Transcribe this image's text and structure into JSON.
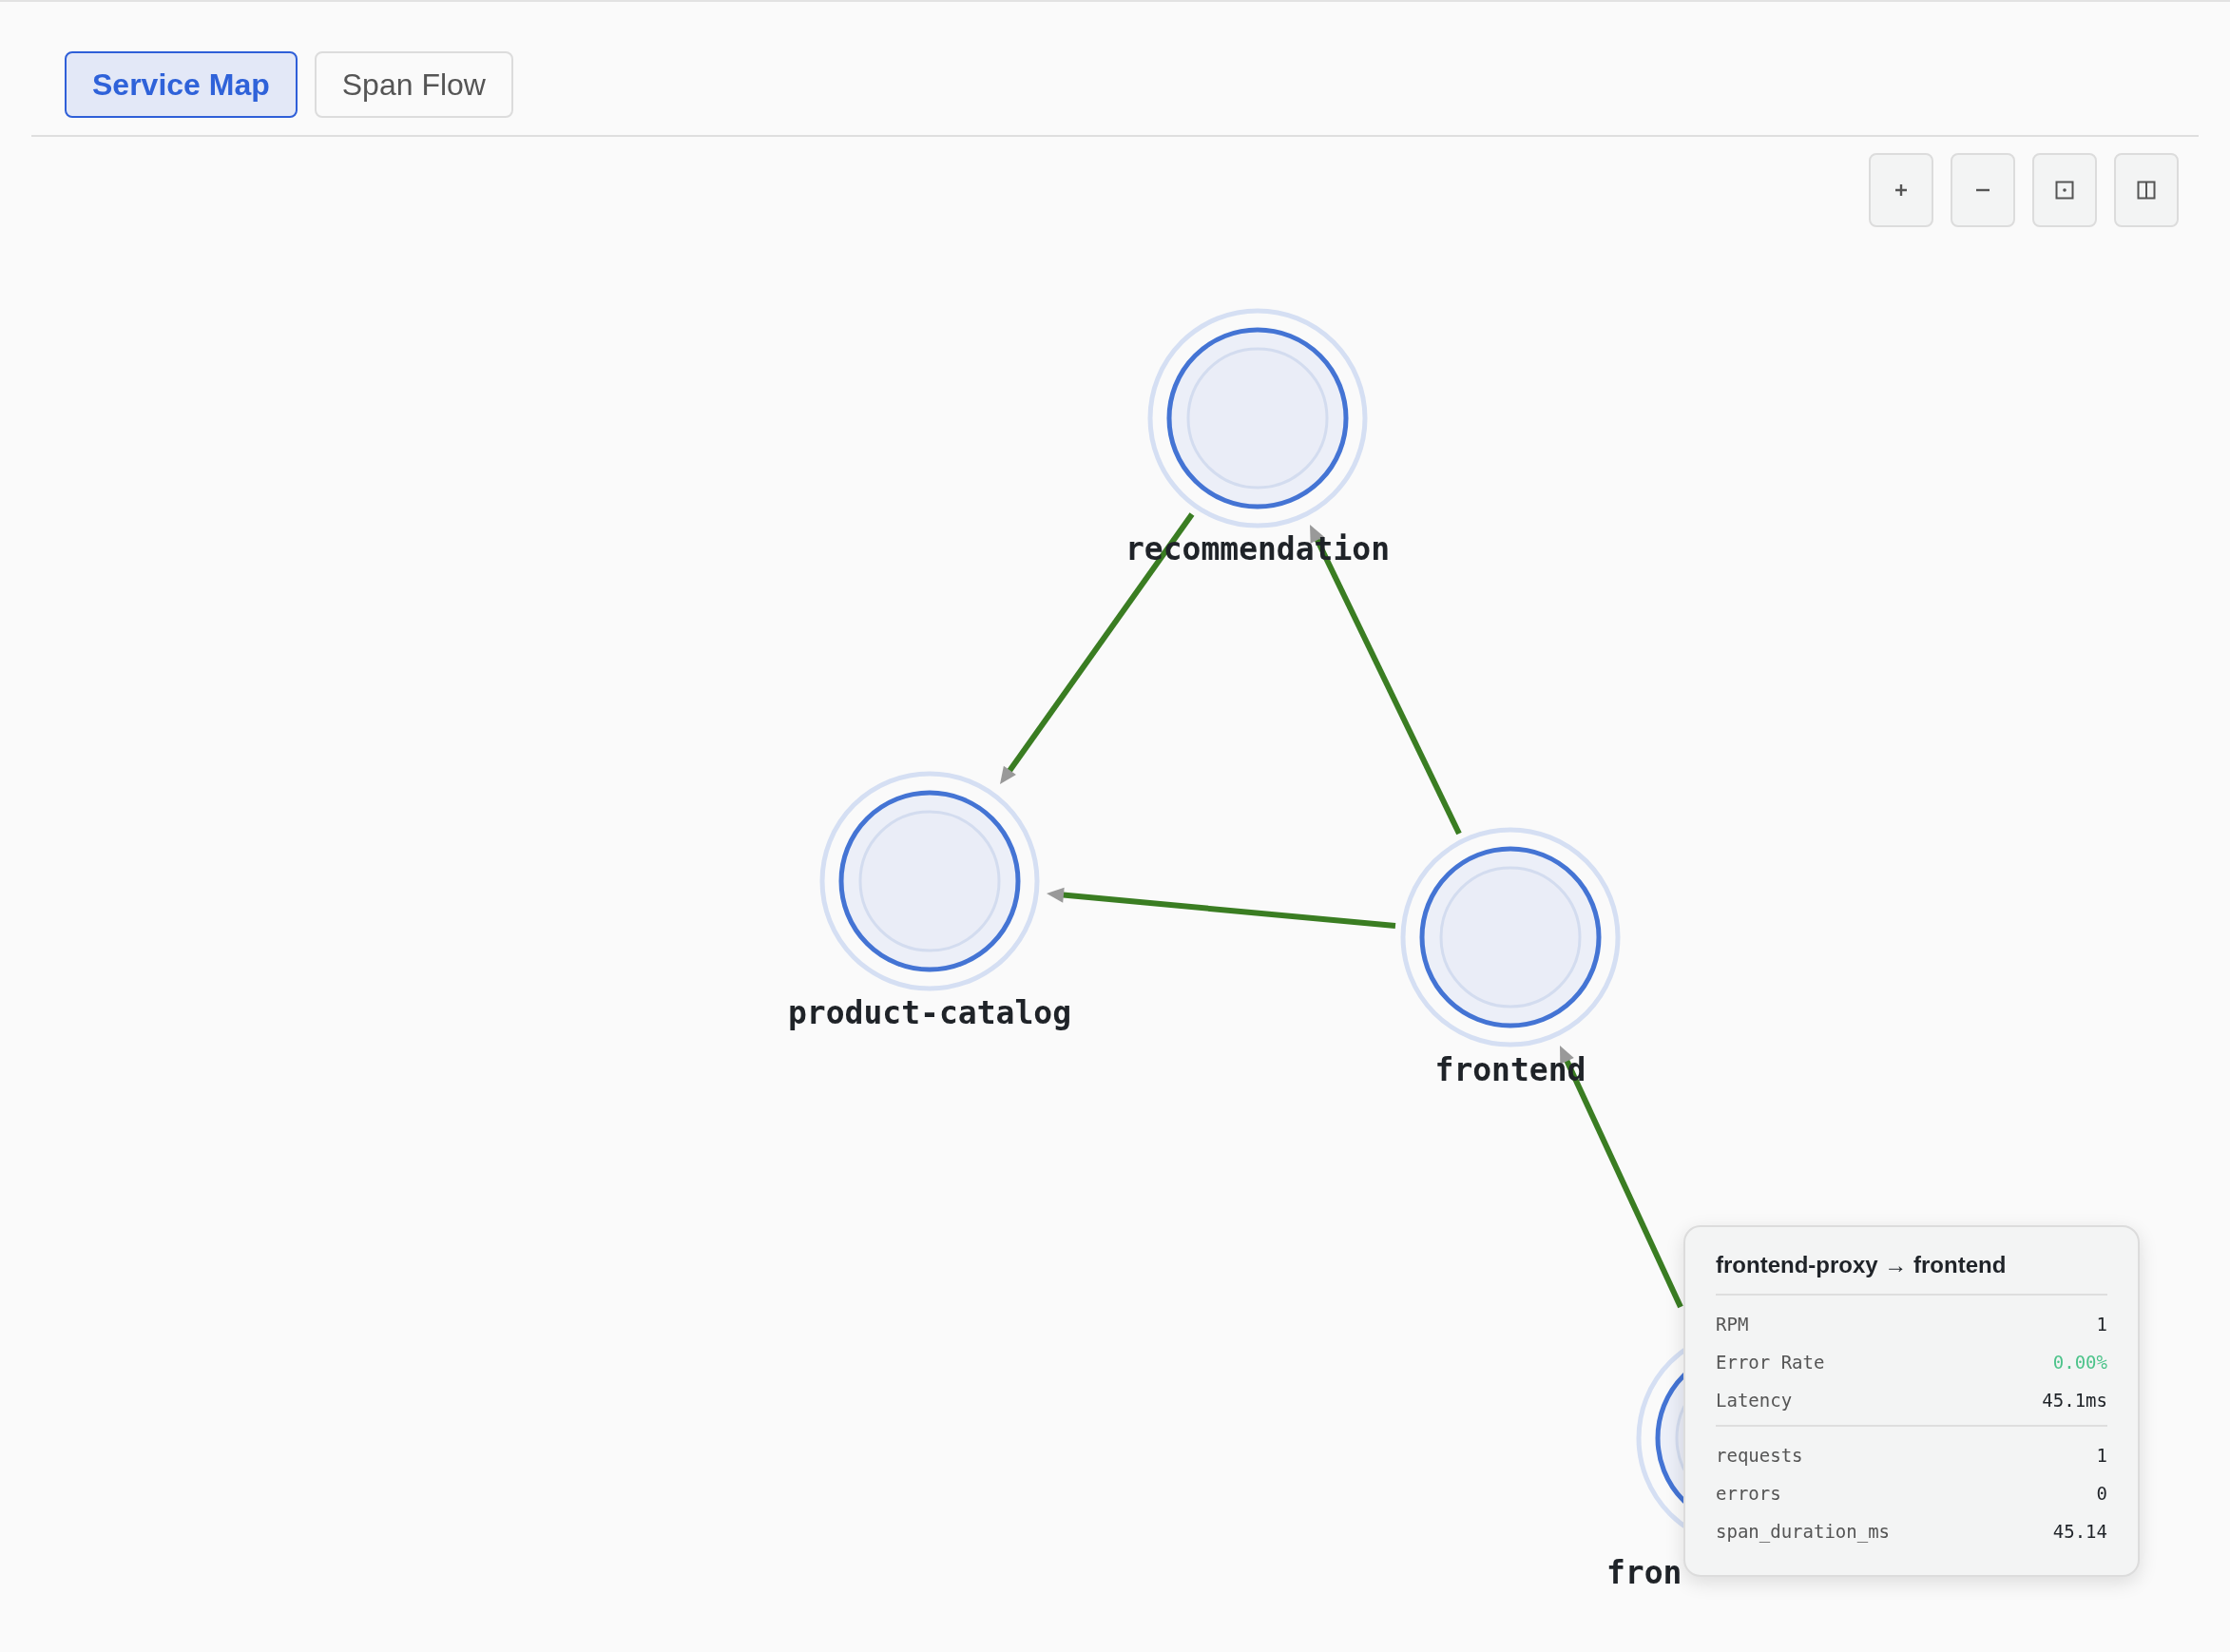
{
  "tabs": [
    {
      "label": "Service Map",
      "selected": true
    },
    {
      "label": "Span Flow",
      "selected": false
    }
  ],
  "nodes": [
    {
      "name": "recommendation"
    },
    {
      "name": "product-catalog"
    },
    {
      "name": "frontend"
    },
    {
      "name": "fron"
    }
  ],
  "tooltip": {
    "title": "frontend-proxy → frontend",
    "metrics": [
      {
        "label": "RPM",
        "value": "1",
        "color": "#1f2328"
      },
      {
        "label": "Error Rate",
        "value": "0.00%",
        "color": "#4cc38a"
      },
      {
        "label": "Latency",
        "value": "45.1ms",
        "color": "#1f2328"
      }
    ],
    "attributes": [
      {
        "label": "requests",
        "value": "1"
      },
      {
        "label": "errors",
        "value": "0"
      },
      {
        "label": "span_duration_ms",
        "value": "45.14"
      }
    ]
  }
}
